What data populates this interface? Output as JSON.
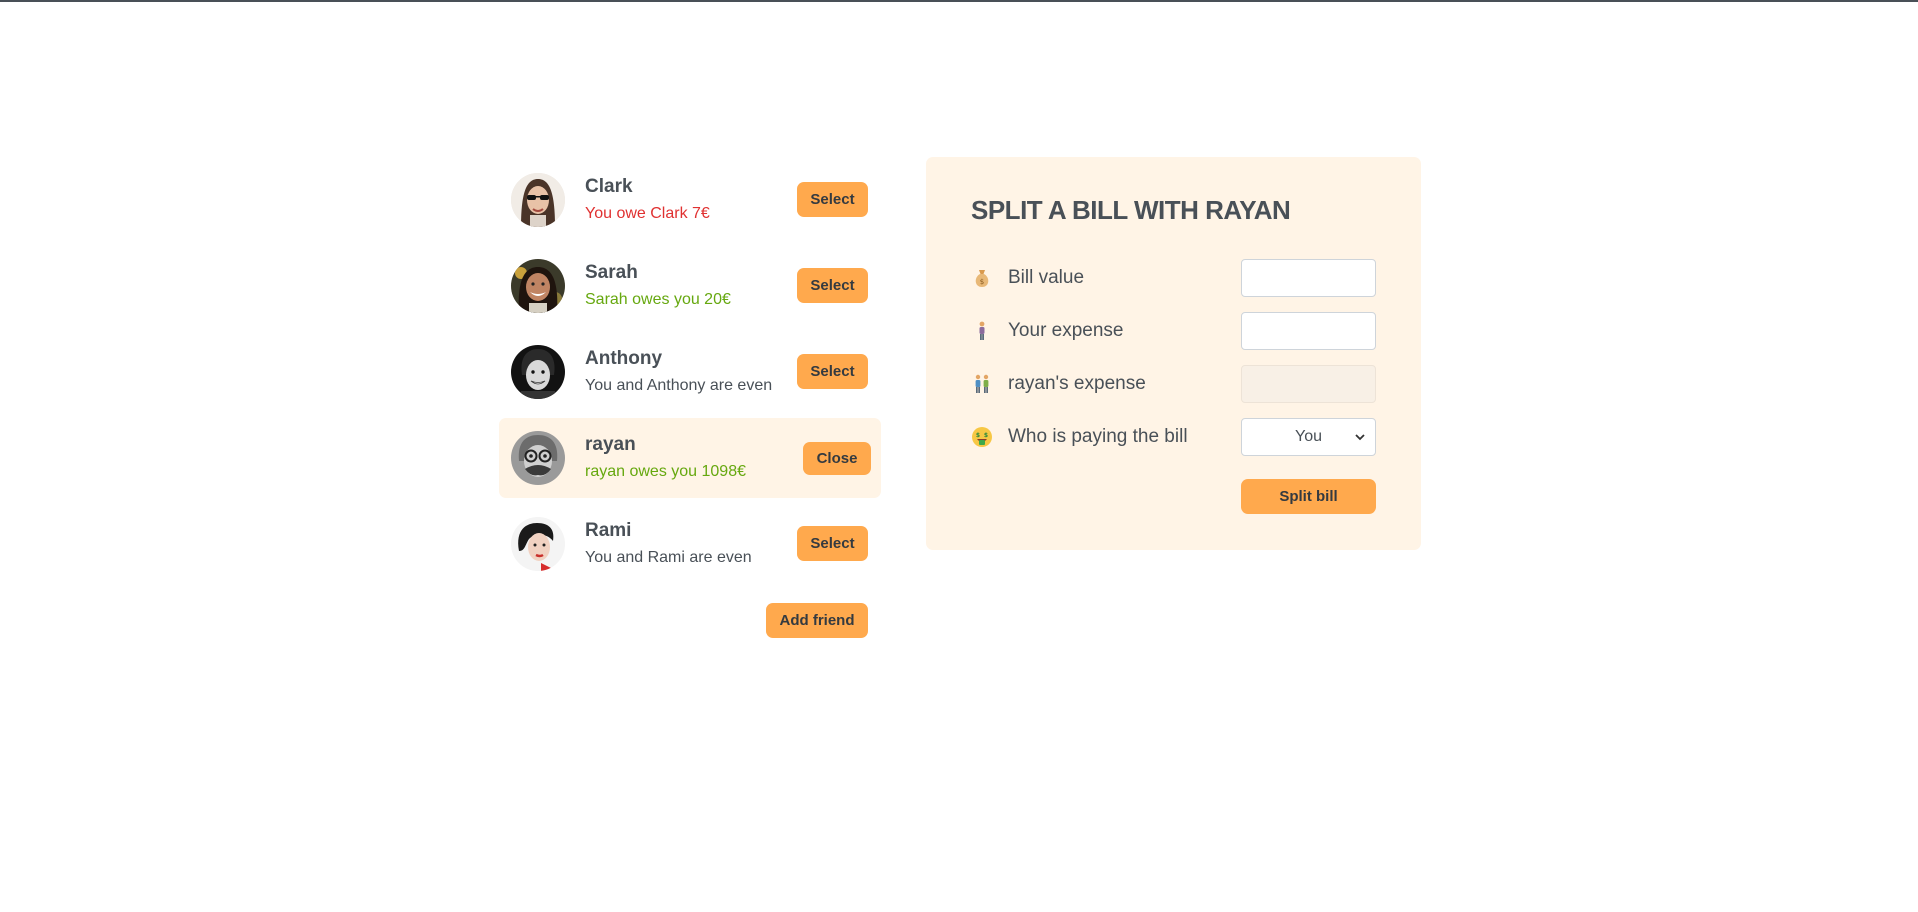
{
  "friends": [
    {
      "name": "Clark",
      "status": "You owe Clark 7€",
      "button": "Select"
    },
    {
      "name": "Sarah",
      "status": "Sarah owes you 20€",
      "button": "Select"
    },
    {
      "name": "Anthony",
      "status": "You and Anthony are even",
      "button": "Select"
    },
    {
      "name": "rayan",
      "status": "rayan owes you 1098€",
      "button": "Close"
    },
    {
      "name": "Rami",
      "status": "You and Rami are even",
      "button": "Select"
    }
  ],
  "add_friend_label": "Add friend",
  "form": {
    "title": "SPLIT A BILL WITH RAYAN",
    "bill_value_label": "Bill value",
    "your_expense_label": "Your expense",
    "friend_expense_label": "rayan's expense",
    "payer_label": "Who is paying the bill",
    "payer_selected": "You",
    "submit_label": "Split bill"
  },
  "colors": {
    "accent": "#ffa94d",
    "selected_bg": "#fff4e6",
    "owe_red": "#e03131",
    "owed_green": "#66a80f",
    "text": "#495057"
  }
}
